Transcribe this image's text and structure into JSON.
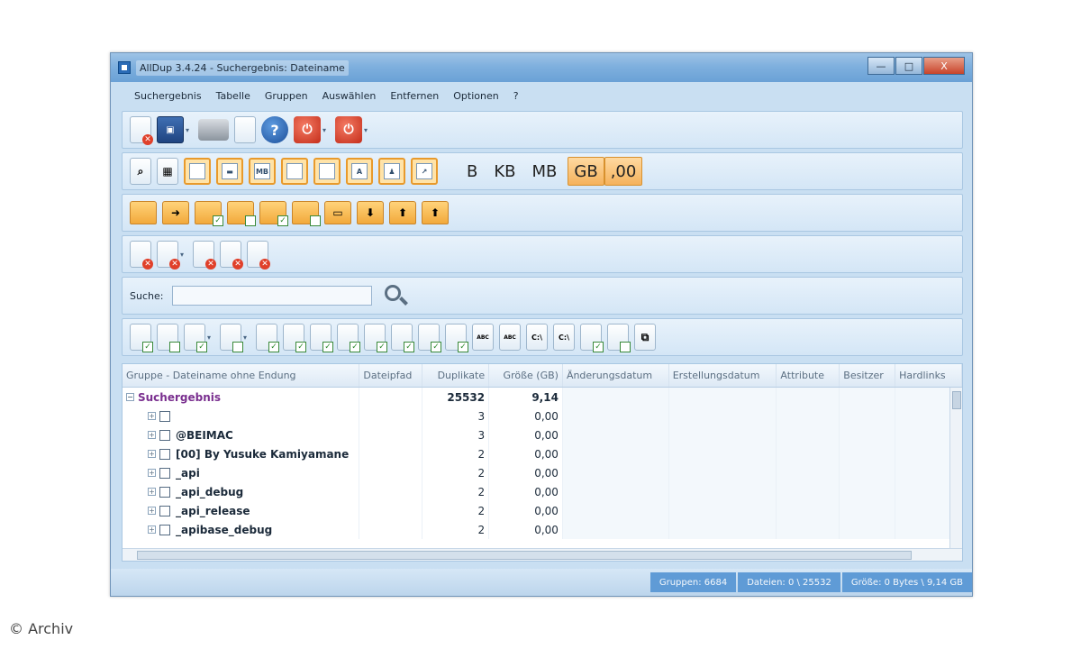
{
  "window": {
    "title": "AllDup 3.4.24 - Suchergebnis: Dateiname",
    "controls": {
      "minimize": "—",
      "maximize": "□",
      "close": "X"
    }
  },
  "menu": [
    "Suchergebnis",
    "Tabelle",
    "Gruppen",
    "Auswählen",
    "Entfernen",
    "Optionen",
    "?"
  ],
  "toolbar_units": {
    "b": "B",
    "kb": "KB",
    "mb": "MB",
    "gb": "GB",
    "decimals": ",00",
    "active": [
      "GB",
      ",00"
    ]
  },
  "toolbar_labels": {
    "mb_icon": "MB",
    "a_icon": "A",
    "abc": "ABC",
    "c_drive": "C:\\"
  },
  "search": {
    "label": "Suche:",
    "value": ""
  },
  "grid": {
    "columns": [
      "Gruppe - Dateiname ohne Endung",
      "Dateipfad",
      "Duplikate",
      "Größe (GB)",
      "Änderungsdatum",
      "Erstellungsdatum",
      "Attribute",
      "Besitzer",
      "Hardlinks"
    ],
    "group": {
      "name": "Suchergebnis",
      "duplicates": "25532",
      "size": "9,14"
    },
    "rows": [
      {
        "name": "",
        "duplicates": "3",
        "size": "0,00"
      },
      {
        "name": "@BEIMAC",
        "duplicates": "3",
        "size": "0,00"
      },
      {
        "name": "[00] By Yusuke Kamiyamane",
        "duplicates": "2",
        "size": "0,00"
      },
      {
        "name": "_api",
        "duplicates": "2",
        "size": "0,00"
      },
      {
        "name": "_api_debug",
        "duplicates": "2",
        "size": "0,00"
      },
      {
        "name": "_api_release",
        "duplicates": "2",
        "size": "0,00"
      },
      {
        "name": "_apibase_debug",
        "duplicates": "2",
        "size": "0,00"
      }
    ]
  },
  "status": {
    "groups": "Gruppen: 6684",
    "files": "Dateien: 0 \\ 25532",
    "size": "Größe: 0 Bytes \\ 9,14 GB"
  },
  "watermark": "© Archiv"
}
